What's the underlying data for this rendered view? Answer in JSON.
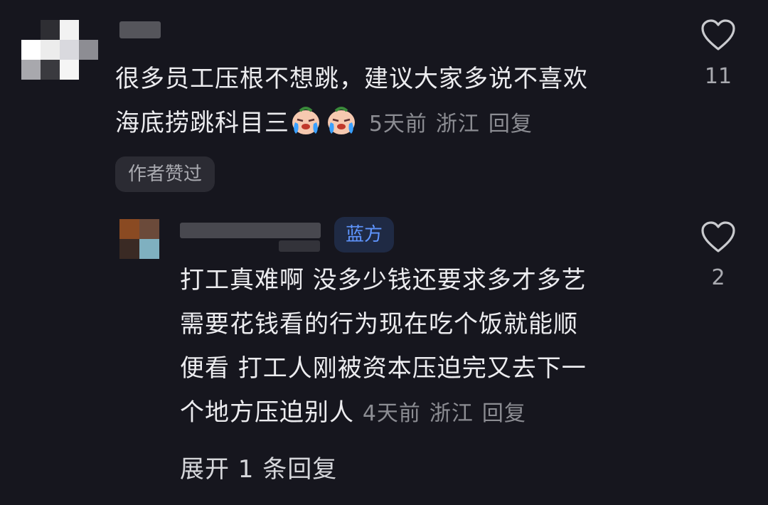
{
  "comment": {
    "text_line1": "很多员工压根不想跳，建议大家多说不喜欢",
    "text_line2": "海底捞跳科目三",
    "emojis": [
      "crying-face-emoji",
      "crying-face-emoji"
    ],
    "time": "5天前",
    "location": "浙江",
    "reply_label": "回复",
    "author_liked_badge": "作者赞过",
    "like_count": "11"
  },
  "reply": {
    "badge": "蓝方",
    "text_line1": "打工真难啊 没多少钱还要求多才多艺",
    "text_line2": "需要花钱看的行为现在吃个饭就能顺",
    "text_line3": "便看 打工人刚被资本压迫完又去下一",
    "text_line4": "个地方压迫别人",
    "time": "4天前",
    "location": "浙江",
    "reply_label": "回复",
    "like_count": "2"
  },
  "expand_replies": "展开 1 条回复",
  "colors": {
    "background": "#16161e",
    "text": "#ececef",
    "meta": "#8c8d93",
    "badge_blue": "#5f95ff"
  }
}
